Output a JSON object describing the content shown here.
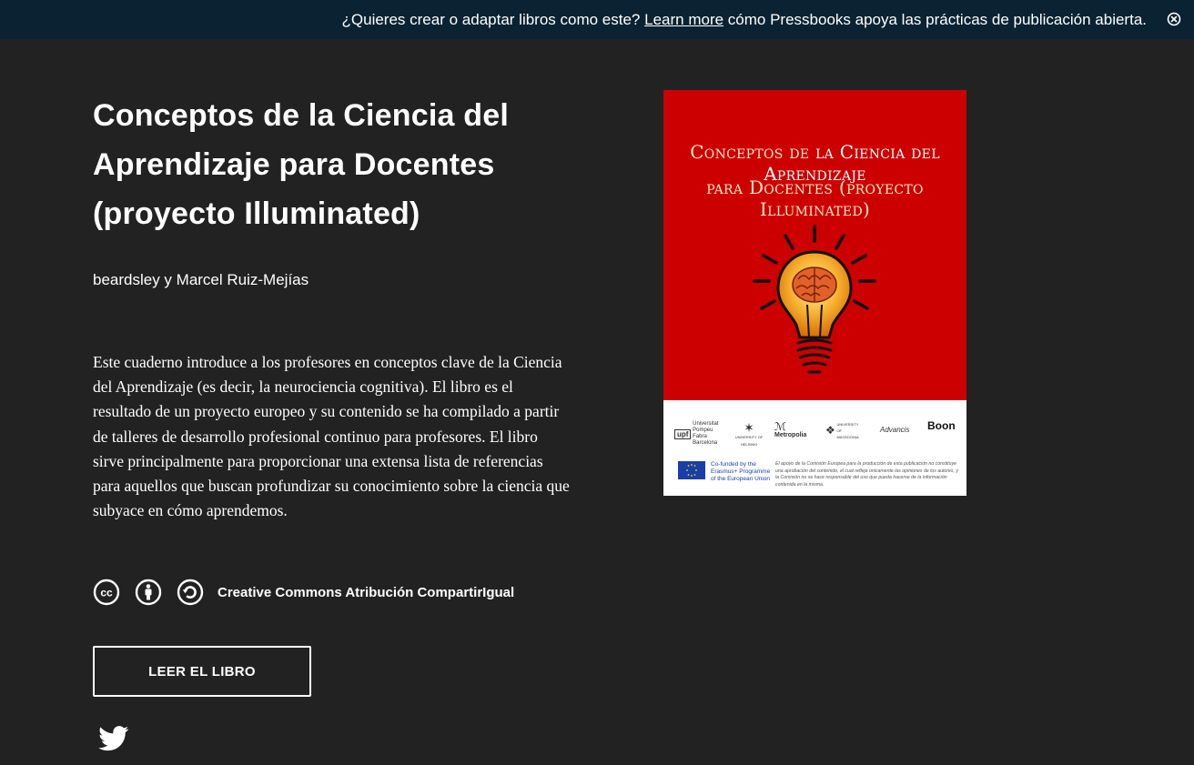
{
  "banner": {
    "before_link": "¿Quieres crear o adaptar libros como este?",
    "link_text": "Learn more",
    "after_link": "cómo Pressbooks apoya las prácticas de publicación abierta.",
    "close_icon": "close-circle-icon"
  },
  "book": {
    "title": "Conceptos de la Ciencia del Aprendizaje para Docentes (proyecto Illuminated)",
    "authors": "beardsley y Marcel Ruiz-Mejías",
    "description": "Este cuaderno introduce a los profesores en conceptos clave de la Ciencia del Aprendizaje (es decir, la neurociencia cognitiva). El libro es el resultado de un proyecto europeo y su contenido se ha compilado a partir de talleres de desarrollo profesional continuo para profesores. El libro sirve principalmente para proporcionar una extensa lista de referencias para aquellos que buscan profundizar su conocimiento sobre la ciencia que subyace en cómo aprendemos.",
    "license": {
      "icons": [
        "cc-icon",
        "by-icon",
        "sa-icon"
      ],
      "label": "Creative Commons Atribución CompartirIgual"
    },
    "read_button": "LEER EL LIBRO",
    "share_icon": "twitter-icon"
  },
  "cover": {
    "title_line1_prefix": "Conceptos de",
    "title_line1_highlight": "la Ciencia del Aprendizaje",
    "title_line2": "para Docentes (proyecto Illuminated)",
    "logos": [
      {
        "name": "upf",
        "text": "Universitat Pompeu Fabra Barcelona"
      },
      {
        "name": "helsinki",
        "text": "UNIVERSITY OF HELSINKI"
      },
      {
        "name": "metropolia",
        "text": "Metropolia"
      },
      {
        "name": "macedonia",
        "text": "UNIVERSITY OF MACEDONIA"
      },
      {
        "name": "advancis",
        "text": "Advancis"
      },
      {
        "name": "boon",
        "text": "Boon"
      }
    ],
    "eu_text": "Co-funded by the Erasmus+ Programme of the European Union",
    "eu_disclaimer": "El apoyo de la Comisión Europea para la producción de esta publicación no constituye una aprobación del contenido, el cual refleja únicamente las opiniones de los autores, y la Comisión no se hace responsable del uso que pueda hacerse de la información contenida en la misma."
  },
  "colors": {
    "background": "#222222",
    "banner": "#0b2233",
    "cover_red": "#cc0000",
    "text": "#ffffff"
  }
}
